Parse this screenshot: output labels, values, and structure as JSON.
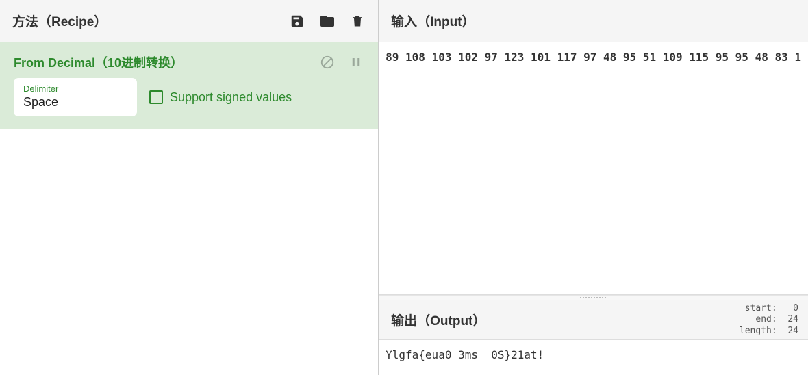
{
  "recipe": {
    "title": "方法（Recipe）",
    "operation": {
      "title": "From Decimal（10进制转换）",
      "delimiter_label": "Delimiter",
      "delimiter_value": "Space",
      "signed_label": "Support signed values",
      "signed_checked": false
    }
  },
  "input": {
    "title": "输入（Input）",
    "text": "89 108 103 102 97 123 101 117 97 48 95 51 109 115 95 95 48 83 1"
  },
  "output": {
    "title": "输出（Output）",
    "text": "Ylgfa{eua0_3ms__0S}21at!",
    "stats": {
      "start": 0,
      "end": 24,
      "length": 24
    }
  }
}
